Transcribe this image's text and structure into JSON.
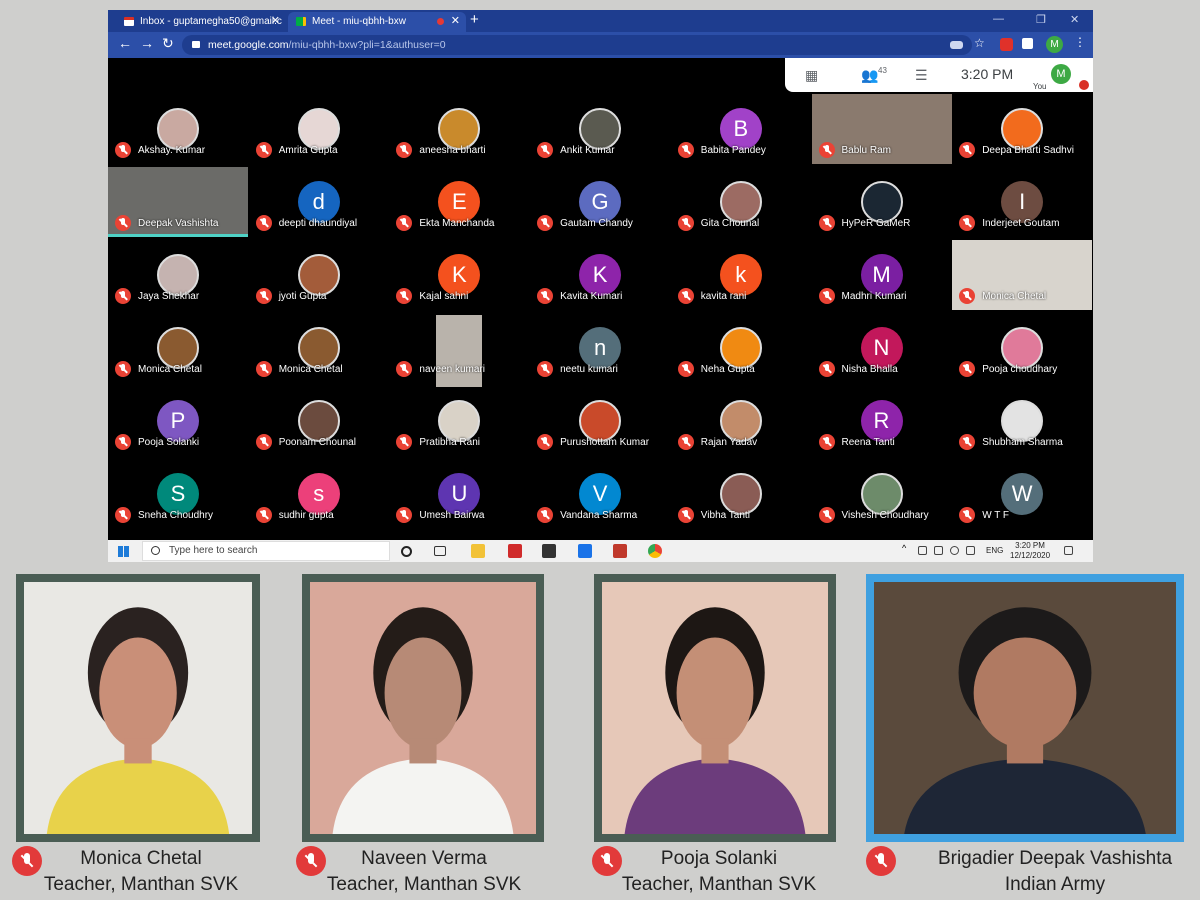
{
  "browser": {
    "tabs": [
      {
        "label": "Inbox - guptamegha50@gmail.c"
      },
      {
        "label": "Meet - miu-qbhh-bxw"
      }
    ],
    "new_tab_icon": "plus",
    "address": {
      "host": "meet.google.com",
      "path": "/miu-qbhh-bxw?pli=1&authuser=0"
    },
    "profile_initial": "M"
  },
  "meet": {
    "participant_count": "43",
    "time": "3:20 PM",
    "you_initial": "M",
    "you_label": "You",
    "participants": [
      {
        "name": "Akshay. Kumar",
        "avatar": "photo",
        "color": "#c9a9a1"
      },
      {
        "name": "Amrita Gupta",
        "avatar": "photo",
        "color": "#e6d7d5"
      },
      {
        "name": "aneesha bharti",
        "avatar": "photo",
        "color": "#c98a2c"
      },
      {
        "name": "Ankit Kumar",
        "avatar": "photo",
        "color": "#5a5a50"
      },
      {
        "name": "Babita Pandey",
        "initial": "B",
        "color": "#a142c8"
      },
      {
        "name": "Bablu Ram",
        "avatar": "video",
        "color": "#8a7a6e"
      },
      {
        "name": "Deepa Bharti Sadhvi",
        "avatar": "photo",
        "color": "#f26b1d"
      },
      {
        "name": "Deepak Vashishta",
        "avatar": "video",
        "color": "#6b6b68",
        "speaking": true
      },
      {
        "name": "deepti dhaundiyal",
        "initial": "d",
        "color": "#1565c0"
      },
      {
        "name": "Ekta Manchanda",
        "initial": "E",
        "color": "#f4511e"
      },
      {
        "name": "Gautam Chandy",
        "initial": "G",
        "color": "#5c6bc0"
      },
      {
        "name": "Gita Chounal",
        "avatar": "photo",
        "color": "#9c6b63"
      },
      {
        "name": "HyPeR GaMeR",
        "avatar": "photo",
        "color": "#1b2733"
      },
      {
        "name": "Inderjeet Goutam",
        "initial": "I",
        "color": "#6d4c41"
      },
      {
        "name": "Jaya Shekhar",
        "avatar": "photo",
        "color": "#c5b3b0"
      },
      {
        "name": "jyoti Gupta",
        "avatar": "photo",
        "color": "#a35c3a"
      },
      {
        "name": "Kajal sahni",
        "initial": "K",
        "color": "#f4511e"
      },
      {
        "name": "Kavita Kumari",
        "initial": "K",
        "color": "#8e24aa"
      },
      {
        "name": "kavita rani",
        "initial": "k",
        "color": "#f4511e"
      },
      {
        "name": "Madhri Kumari",
        "initial": "M",
        "color": "#7b1fa2"
      },
      {
        "name": "Monica Chetal",
        "avatar": "video",
        "color": "#d8d4cd"
      },
      {
        "name": "Monica Chetal",
        "avatar": "photo",
        "color": "#8a5a30"
      },
      {
        "name": "Monica Chetal",
        "avatar": "photo",
        "color": "#8a5a30"
      },
      {
        "name": "naveen kumari",
        "avatar": "mini",
        "color": "#b9b3ab"
      },
      {
        "name": "neetu kumari",
        "initial": "n",
        "color": "#546e7a"
      },
      {
        "name": "Neha Gupta",
        "avatar": "photo",
        "color": "#f08a12"
      },
      {
        "name": "Nisha Bhalla",
        "initial": "N",
        "color": "#c2185b"
      },
      {
        "name": "Pooja choudhary",
        "avatar": "photo",
        "color": "#e07a9a"
      },
      {
        "name": "Pooja Solanki",
        "initial": "P",
        "color": "#7e57c2"
      },
      {
        "name": "Poonam Chounal",
        "avatar": "photo",
        "color": "#6b4b3e"
      },
      {
        "name": "Pratibha Rani",
        "avatar": "photo",
        "color": "#d9d2c7"
      },
      {
        "name": "Purushottam Kumar",
        "avatar": "photo",
        "color": "#c94a2a"
      },
      {
        "name": "Rajan Yadav",
        "avatar": "photo",
        "color": "#c28c6a"
      },
      {
        "name": "Reena Tanti",
        "initial": "R",
        "color": "#8e24aa"
      },
      {
        "name": "Shubham Sharma",
        "avatar": "photo",
        "color": "#e3e3e3"
      },
      {
        "name": "Sneha Choudhry",
        "initial": "S",
        "color": "#00897b"
      },
      {
        "name": "sudhir gupta",
        "initial": "s",
        "color": "#ec407a"
      },
      {
        "name": "Umesh Bairwa",
        "initial": "U",
        "color": "#5e35b1"
      },
      {
        "name": "Vandana Sharma",
        "initial": "V",
        "color": "#0288d1"
      },
      {
        "name": "Vibha Tanti",
        "avatar": "photo",
        "color": "#8a5c55"
      },
      {
        "name": "Vishesh Choudhary",
        "avatar": "photo",
        "color": "#6d8b6a"
      },
      {
        "name": "W T F",
        "initial": "W",
        "color": "#546e7a"
      }
    ]
  },
  "taskbar": {
    "search_placeholder": "Type here to search",
    "lang": "ENG",
    "time": "3:20 PM",
    "date": "12/12/2020"
  },
  "speakers": [
    {
      "name": "Monica Chetal",
      "role": "Teacher, Manthan SVK",
      "skin": "#c98f78",
      "bg": "#e9e8e4",
      "shirt": "#e8d24a",
      "hair": "#2a2220",
      "frame": "green"
    },
    {
      "name": "Naveen Verma",
      "role": "Teacher, Manthan SVK",
      "skin": "#b78a76",
      "bg": "#d9a89a",
      "shirt": "#f4f4f2",
      "hair": "#241c18",
      "frame": "green"
    },
    {
      "name": "Pooja Solanki",
      "role": "Teacher, Manthan SVK",
      "skin": "#c48f76",
      "bg": "#e6c8b8",
      "shirt": "#6c3c7c",
      "hair": "#1d1714",
      "frame": "green"
    },
    {
      "name": "Brigadier Deepak Vashishta",
      "role": "Indian Army",
      "skin": "#b07a62",
      "bg": "#5a4a3c",
      "shirt": "#1e2636",
      "hair": "#1c1a1a",
      "frame": "blue"
    }
  ]
}
